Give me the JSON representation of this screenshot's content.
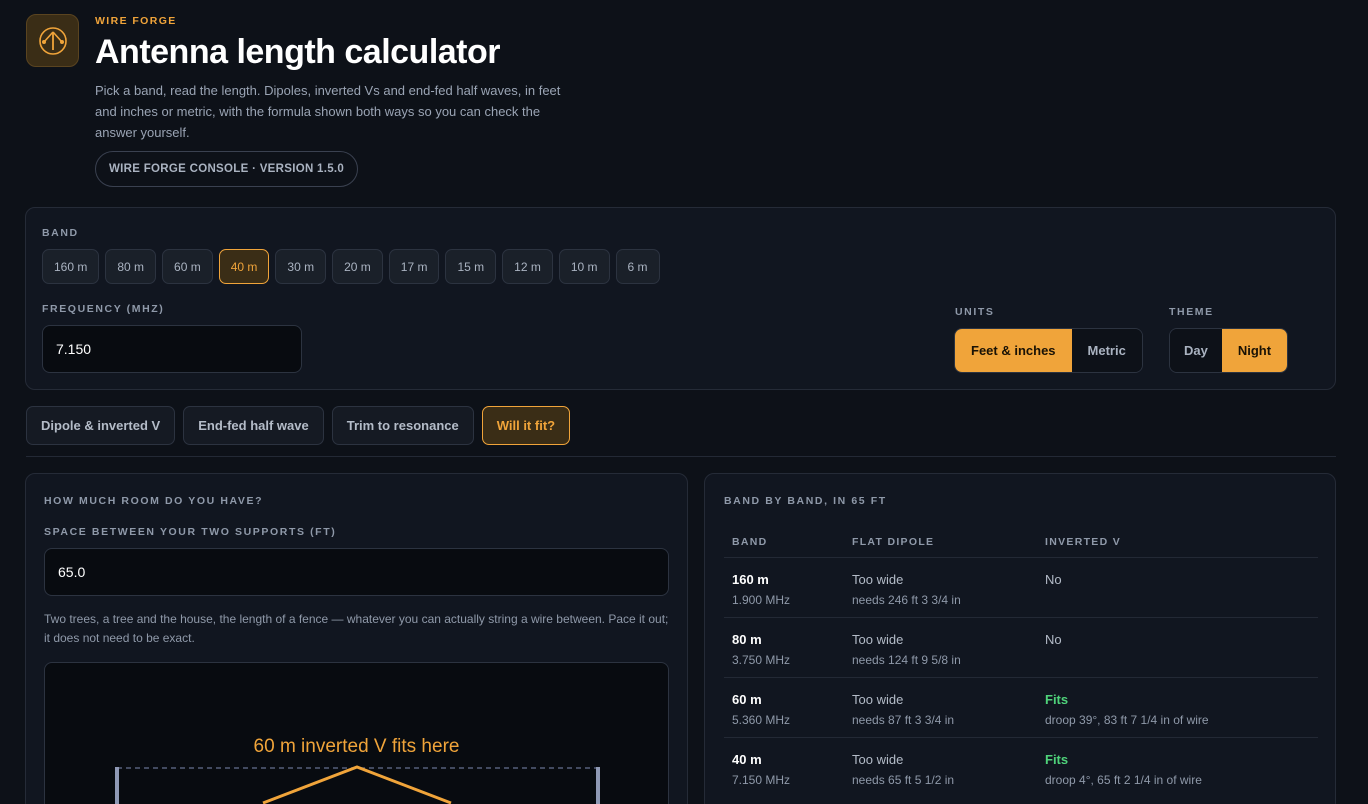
{
  "header": {
    "kicker": "WIRE FORGE",
    "title": "Antenna length calculator",
    "intro": "Pick a band, read the length. Dipoles, inverted Vs and end-fed half waves, in feet and inches or metric, with the formula shown both ways so you can check the answer yourself.",
    "version": "WIRE FORGE CONSOLE · VERSION 1.5.0",
    "logo_icon": "antenna-icon"
  },
  "controls": {
    "band_label": "BAND",
    "bands": [
      "160 m",
      "80 m",
      "60 m",
      "40 m",
      "30 m",
      "20 m",
      "17 m",
      "15 m",
      "12 m",
      "10 m",
      "6 m"
    ],
    "active_band": "40 m",
    "frequency_label": "FREQUENCY (MHZ)",
    "frequency_value": "7.150",
    "units_label": "UNITS",
    "units": [
      "Feet & inches",
      "Metric"
    ],
    "active_unit": "Feet & inches",
    "theme_label": "THEME",
    "themes": [
      "Day",
      "Night"
    ],
    "active_theme": "Night"
  },
  "tabs": [
    "Dipole & inverted V",
    "End-fed half wave",
    "Trim to resonance",
    "Will it fit?"
  ],
  "active_tab": "Will it fit?",
  "fit": {
    "heading": "HOW MUCH ROOM DO YOU HAVE?",
    "space_label": "SPACE BETWEEN YOUR TWO SUPPORTS (FT)",
    "space_value": "65.0",
    "hint": "Two trees, a tree and the house, the length of a fence — whatever you can actually string a wire between. Pace it out; it does not need to be exact.",
    "diagram_caption": "60 m inverted V fits here"
  },
  "band_table": {
    "heading": "BAND BY BAND, IN 65 FT",
    "columns": [
      "BAND",
      "FLAT DIPOLE",
      "INVERTED V"
    ],
    "rows": [
      {
        "band": "160 m",
        "freq": "1.900 MHz",
        "dipole": "Too wide",
        "dipole_note": "needs 246 ft 3 3/4 in",
        "inv": "No",
        "inv_note": "",
        "fits": false
      },
      {
        "band": "80 m",
        "freq": "3.750 MHz",
        "dipole": "Too wide",
        "dipole_note": "needs 124 ft 9 5/8 in",
        "inv": "No",
        "inv_note": "",
        "fits": false
      },
      {
        "band": "60 m",
        "freq": "5.360 MHz",
        "dipole": "Too wide",
        "dipole_note": "needs 87 ft 3 3/4 in",
        "inv": "Fits",
        "inv_note": "droop 39°, 83 ft 7 1/4 in of wire",
        "fits": true
      },
      {
        "band": "40 m",
        "freq": "7.150 MHz",
        "dipole": "Too wide",
        "dipole_note": "needs 65 ft 5 1/2 in",
        "inv": "Fits",
        "inv_note": "droop 4°, 65 ft 2 1/4 in of wire",
        "fits": true
      }
    ]
  },
  "colors": {
    "accent": "#f0a43a",
    "background": "#0d1118",
    "fits": "#4fd27a"
  }
}
